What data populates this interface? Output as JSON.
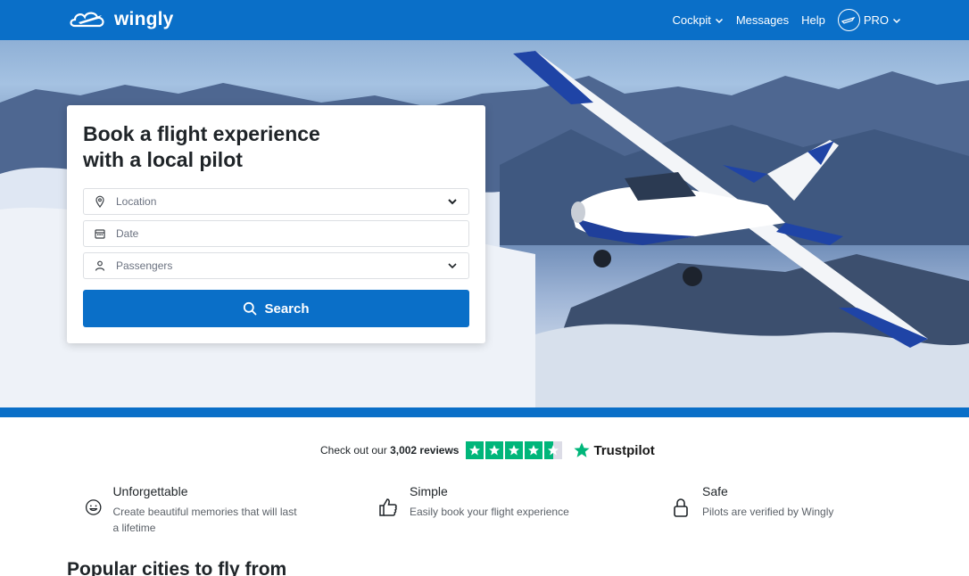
{
  "brand": {
    "name": "wingly",
    "color": "#0a6fc8"
  },
  "nav": {
    "cockpit": "Cockpit",
    "messages": "Messages",
    "help": "Help",
    "pro": "PRO"
  },
  "booking": {
    "title_line1": "Book a flight experience",
    "title_line2": "with a local pilot",
    "location_placeholder": "Location",
    "date_placeholder": "Date",
    "passengers_placeholder": "Passengers",
    "search_label": "Search"
  },
  "trustpilot": {
    "prefix": "Check out our",
    "count": "3,002 reviews",
    "rating_stars": 4.5,
    "brand": "Trustpilot"
  },
  "features": [
    {
      "icon": "smiley-icon",
      "title": "Unforgettable",
      "text": "Create beautiful memories that will last a lifetime"
    },
    {
      "icon": "thumbs-up-icon",
      "title": "Simple",
      "text": "Easily book your flight experience"
    },
    {
      "icon": "lock-icon",
      "title": "Safe",
      "text": "Pilots are verified by Wingly"
    }
  ],
  "popular_heading": "Popular cities to fly from"
}
